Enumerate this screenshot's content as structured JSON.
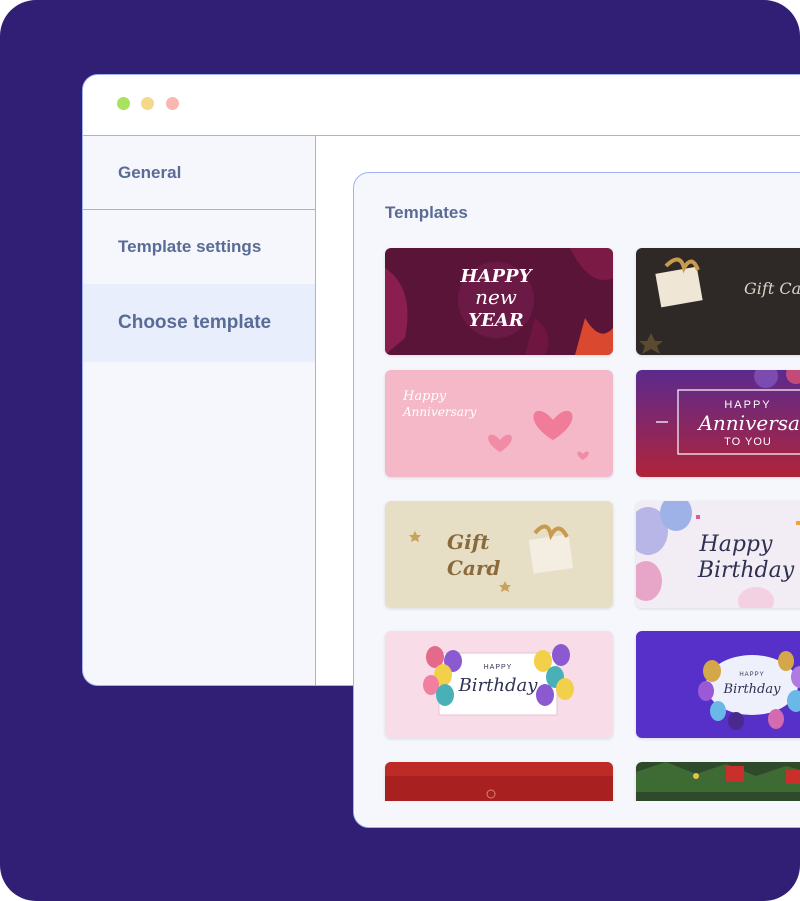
{
  "sidebar": {
    "items": [
      {
        "label": "General"
      },
      {
        "label": "Template settings"
      },
      {
        "label": "Choose template",
        "active": true
      }
    ]
  },
  "templates_panel": {
    "title": "Templates",
    "cards": [
      {
        "name": "happy-new-year",
        "text_lines": [
          "HAPPY",
          "new",
          "YEAR"
        ]
      },
      {
        "name": "gift-card-dark",
        "text_lines": [
          "Gift Ca"
        ]
      },
      {
        "name": "happy-anniversary-pink",
        "text_lines": [
          "Happy",
          "Anniversary"
        ]
      },
      {
        "name": "happy-anniversary-purple",
        "text_lines": [
          "HAPPY",
          "Anniversar",
          "TO YOU"
        ]
      },
      {
        "name": "gift-card-gold",
        "text_lines": [
          "Gift",
          "Card"
        ]
      },
      {
        "name": "happy-birthday-balloons",
        "text_lines": [
          "Happy",
          "Birthday"
        ]
      },
      {
        "name": "happy-birthday-pink",
        "text_lines": [
          "HAPPY",
          "Birthday"
        ]
      },
      {
        "name": "happy-birthday-purple",
        "text_lines": [
          "HAPPY",
          "Birthday"
        ]
      },
      {
        "name": "red-template",
        "text_lines": []
      },
      {
        "name": "christmas-template",
        "text_lines": []
      }
    ]
  },
  "colors": {
    "background": "#311f75",
    "border": "#9db3f1",
    "nav_text": "#5a6b96",
    "active_bg": "#e9eefd"
  }
}
